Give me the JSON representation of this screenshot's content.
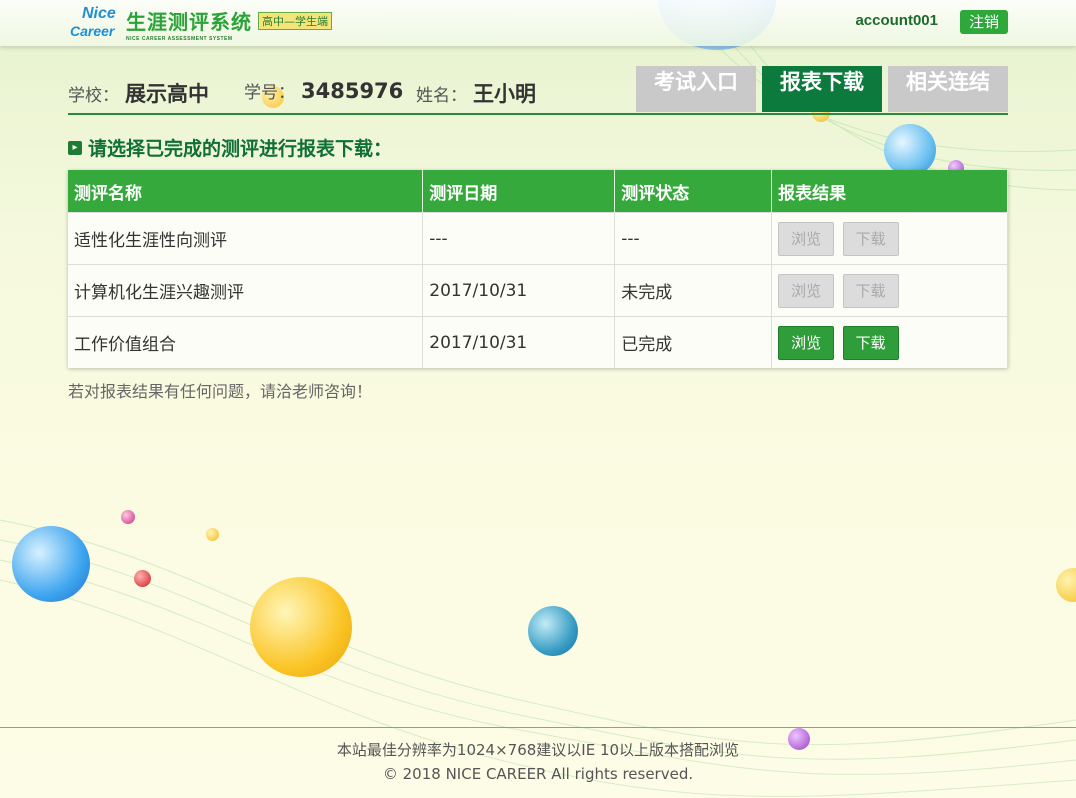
{
  "header": {
    "logo": {
      "brand_line1": "Nice",
      "brand_line2": "Career",
      "title": "生涯测评系统",
      "subtitle": "高中—学生端",
      "english": "NICE CAREER ASSESSMENT SYSTEM"
    },
    "account": "account001",
    "logout_label": "注销"
  },
  "info": {
    "school_label": "学校：",
    "school_value": "展示高中",
    "student_id_label": "学号：",
    "student_id_value": "3485976",
    "name_label": "姓名：",
    "name_value": "王小明"
  },
  "tabs": [
    {
      "label": "考试入口",
      "active": false
    },
    {
      "label": "报表下载",
      "active": true
    },
    {
      "label": "相关连结",
      "active": false
    }
  ],
  "section_title": "请选择已完成的测评进行报表下载：",
  "table": {
    "headers": [
      "测评名称",
      "测评日期",
      "测评状态",
      "报表结果"
    ],
    "rows": [
      {
        "name": "适性化生涯性向测评",
        "date": "---",
        "status": "---",
        "view": "浏览",
        "download": "下载",
        "enabled": false
      },
      {
        "name": "计算机化生涯兴趣测评",
        "date": "2017/10/31",
        "status": "未完成",
        "view": "浏览",
        "download": "下载",
        "enabled": false
      },
      {
        "name": "工作价值组合",
        "date": "2017/10/31",
        "status": "已完成",
        "view": "浏览",
        "download": "下载",
        "enabled": true
      }
    ]
  },
  "note": "若对报表结果有任何问题，请洽老师咨询！",
  "footer": {
    "line1": "本站最佳分辨率为1024×768建议以IE 10以上版本搭配浏览",
    "line2": "© 2018 NICE CAREER All rights reserved."
  },
  "colors": {
    "accent_green": "#36a93d",
    "dark_green": "#0c7a3c",
    "tab_inactive": "#c9c9c9"
  }
}
